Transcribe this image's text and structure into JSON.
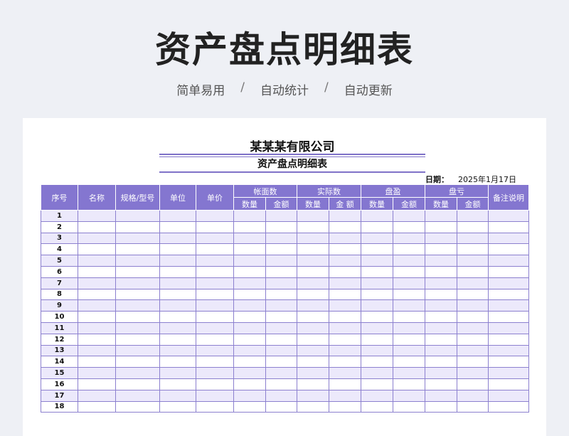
{
  "hero": {
    "title": "资产盘点明细表",
    "tags": [
      "简单易用",
      "自动统计",
      "自动更新"
    ],
    "separator": "/"
  },
  "sheet": {
    "company": "某某某有限公司",
    "title": "资产盘点明细表",
    "date_label": "日期：",
    "date_value": "2025年1月17日",
    "header_color": "#8476d0",
    "alt_row_color": "#ece9fb"
  },
  "table": {
    "headers": {
      "seq": "序号",
      "name": "名称",
      "spec": "规格/型号",
      "unit": "单位",
      "price": "单价",
      "book": "帐面数",
      "actual": "实际数",
      "surplus": "盘盈",
      "deficit": "盘亏",
      "remark": "备注说明",
      "qty": "数量",
      "amount": "金额",
      "amount_spaced": "金 额"
    },
    "rows": [
      "1",
      "2",
      "3",
      "4",
      "5",
      "6",
      "7",
      "8",
      "9",
      "10",
      "11",
      "12",
      "13",
      "14",
      "15",
      "16",
      "17",
      "18"
    ]
  }
}
